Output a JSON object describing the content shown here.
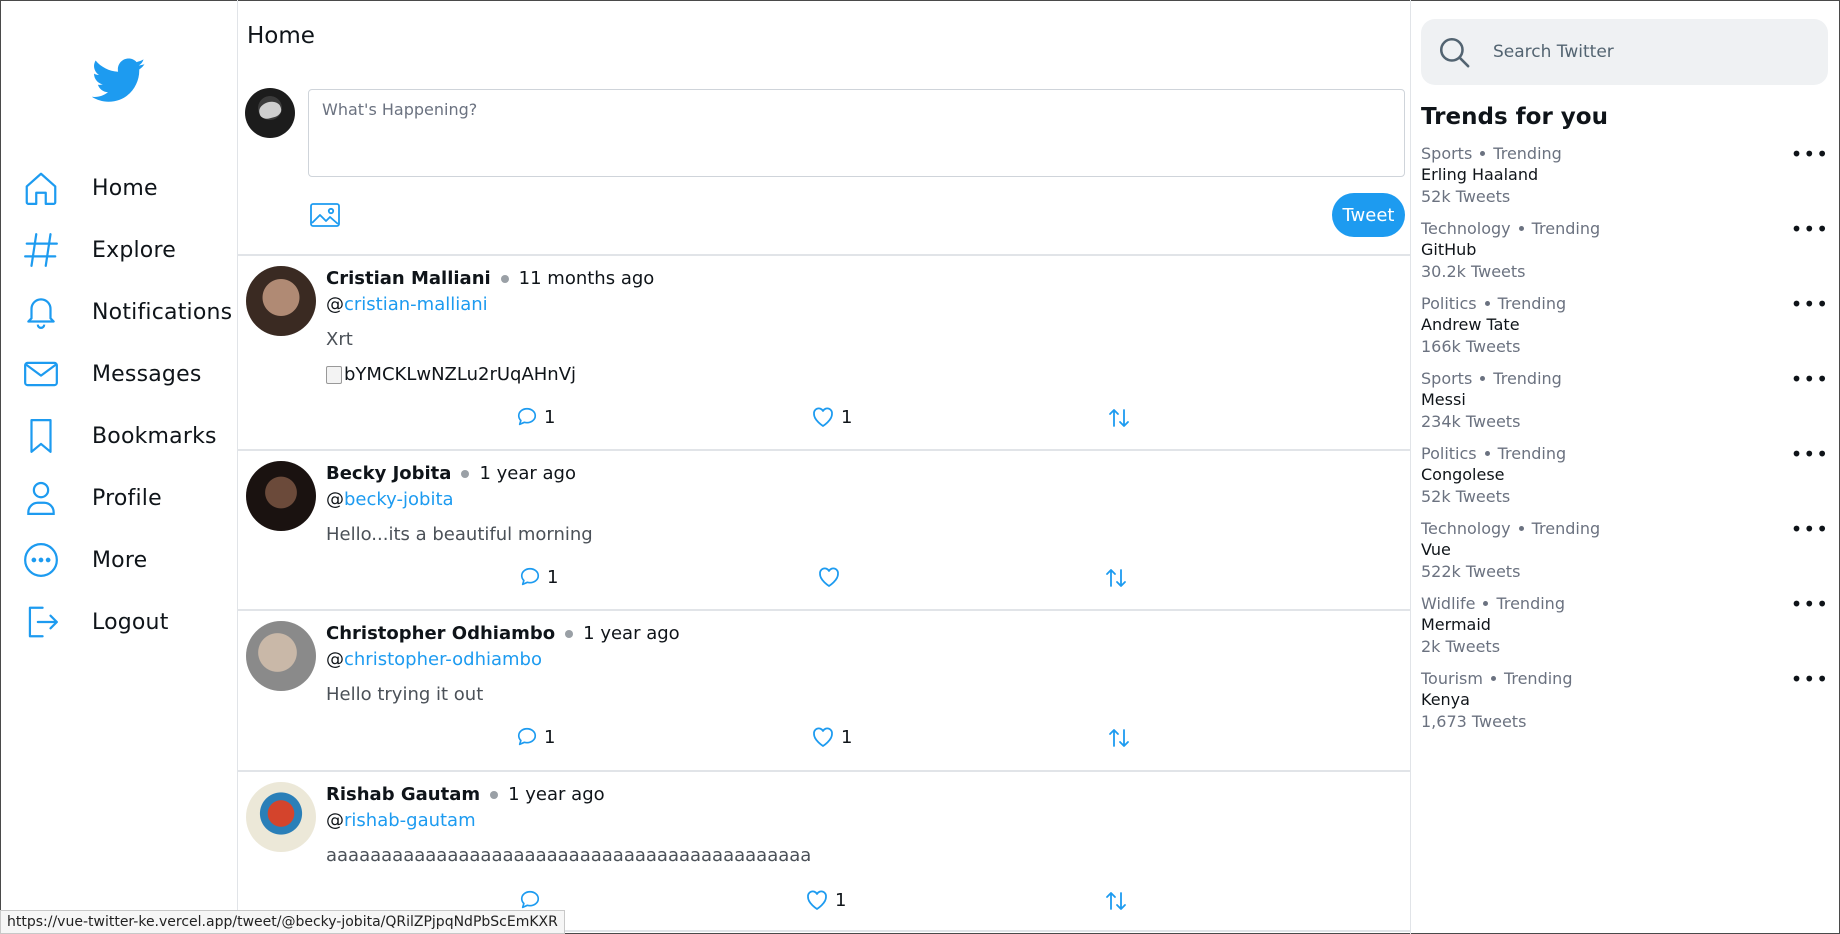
{
  "sidebar": {
    "logo": "twitter-bird-icon",
    "brand_color": "#1d9bf0",
    "items": [
      {
        "label": "Home",
        "icon": "home-icon"
      },
      {
        "label": "Explore",
        "icon": "hashtag-icon"
      },
      {
        "label": "Notifications",
        "icon": "bell-icon"
      },
      {
        "label": "Messages",
        "icon": "envelope-icon"
      },
      {
        "label": "Bookmarks",
        "icon": "bookmark-icon"
      },
      {
        "label": "Profile",
        "icon": "user-icon"
      },
      {
        "label": "More",
        "icon": "more-circle-icon"
      },
      {
        "label": "Logout",
        "icon": "logout-icon"
      }
    ]
  },
  "main": {
    "title": "Home",
    "composer": {
      "placeholder": "What's Happening?",
      "tweet_button": "Tweet"
    },
    "tweets": [
      {
        "name": "Cristian Malliani",
        "time": "11 months ago",
        "handle_prefix": "@",
        "handle": "cristian-malliani",
        "text": "Xrt",
        "image_alt": "bYMCKLwNZLu2rUqAHnVj",
        "replies": "1",
        "likes": "1"
      },
      {
        "name": "Becky Jobita",
        "time": "1 year ago",
        "handle_prefix": "@",
        "handle": "becky-jobita",
        "text": "Hello...its a beautiful morning",
        "replies": "1",
        "likes": ""
      },
      {
        "name": "Christopher Odhiambo",
        "time": "1 year ago",
        "handle_prefix": "@",
        "handle": "christopher-odhiambo",
        "text": "Hello trying it out",
        "replies": "1",
        "likes": "1"
      },
      {
        "name": "Rishab Gautam",
        "time": "1 year ago",
        "handle_prefix": "@",
        "handle": "rishab-gautam",
        "text": "aaaaaaaaaaaaaaaaaaaaaaaaaaaaaaaaaaaaaaaaaaaa",
        "replies": "",
        "likes": "1"
      }
    ]
  },
  "right": {
    "search_placeholder": "Search Twitter",
    "trends_title": "Trends for you",
    "trends": [
      {
        "category": "Sports",
        "status": "Trending",
        "topic": "Erling Haaland",
        "count": "52k Tweets"
      },
      {
        "category": "Technology",
        "status": "Trending",
        "topic": "GitHub",
        "count": "30.2k Tweets"
      },
      {
        "category": "Politics",
        "status": "Trending",
        "topic": "Andrew Tate",
        "count": "166k Tweets"
      },
      {
        "category": "Sports",
        "status": "Trending",
        "topic": "Messi",
        "count": "234k Tweets"
      },
      {
        "category": "Politics",
        "status": "Trending",
        "topic": "Congolese",
        "count": "52k Tweets"
      },
      {
        "category": "Technology",
        "status": "Trending",
        "topic": "Vue",
        "count": "522k Tweets"
      },
      {
        "category": "Widlife",
        "status": "Trending",
        "topic": "Mermaid",
        "count": "2k Tweets"
      },
      {
        "category": "Tourism",
        "status": "Trending",
        "topic": "Kenya",
        "count": "1,673 Tweets"
      }
    ],
    "more_glyph": "•••"
  },
  "statusbar": {
    "url": "https://vue-twitter-ke.vercel.app/tweet/@becky-jobita/QRilZPjpqNdPbScEmKXR"
  }
}
